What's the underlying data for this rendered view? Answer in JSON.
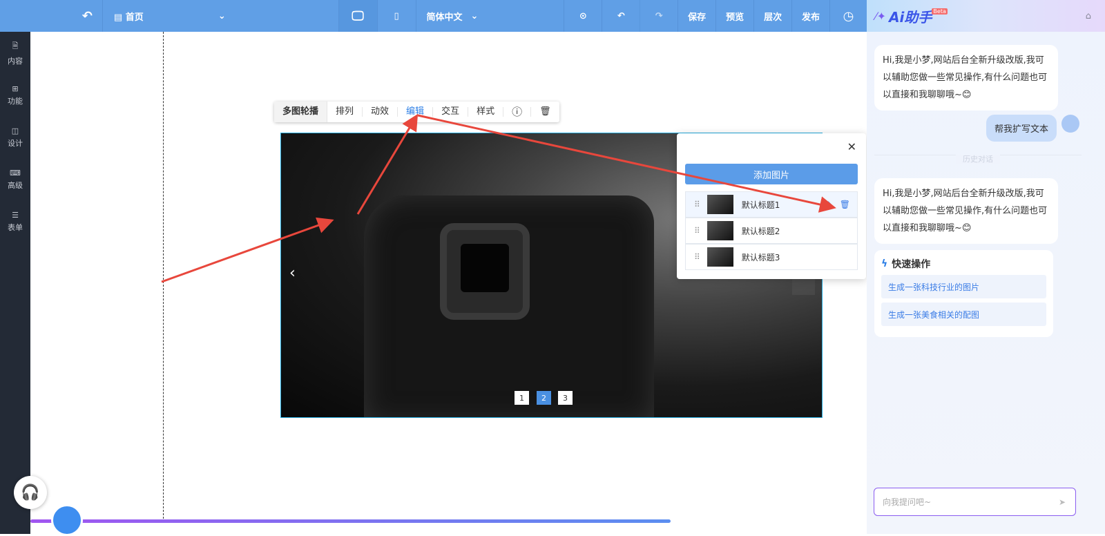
{
  "topbar": {
    "page": "首页",
    "language": "简体中文",
    "save": "保存",
    "preview": "预览",
    "layers": "层次",
    "publish": "发布"
  },
  "sidebar": [
    {
      "label": "内容"
    },
    {
      "label": "功能"
    },
    {
      "label": "设计"
    },
    {
      "label": "高级"
    },
    {
      "label": "表单"
    }
  ],
  "toolbar": {
    "items": [
      "多图轮播",
      "排列",
      "动效",
      "编辑",
      "交互",
      "样式"
    ],
    "active": "编辑"
  },
  "slider": {
    "pages": [
      "1",
      "2",
      "3"
    ],
    "current": "2"
  },
  "popup": {
    "add_button": "添加图片",
    "items": [
      {
        "title": "默认标题1"
      },
      {
        "title": "默认标题2"
      },
      {
        "title": "默认标题3"
      }
    ]
  },
  "assistant": {
    "title": "Ai助手",
    "badge": "Beta",
    "greeting": "Hi,我是小梦,网站后台全新升级改版,我可以辅助您做一些常见操作,有什么问题也可以直接和我聊聊哦~😊",
    "user_msg": "帮我扩写文本",
    "divider": "历史对话",
    "quick_title": "快速操作",
    "quick_items": [
      "生成一张科技行业的图片",
      "生成一张美食相关的配图"
    ],
    "input_placeholder": "向我提问吧~"
  },
  "colors": {
    "topbar": "#609fe6",
    "accent": "#3a7ce6",
    "arrow": "#e8473c"
  }
}
